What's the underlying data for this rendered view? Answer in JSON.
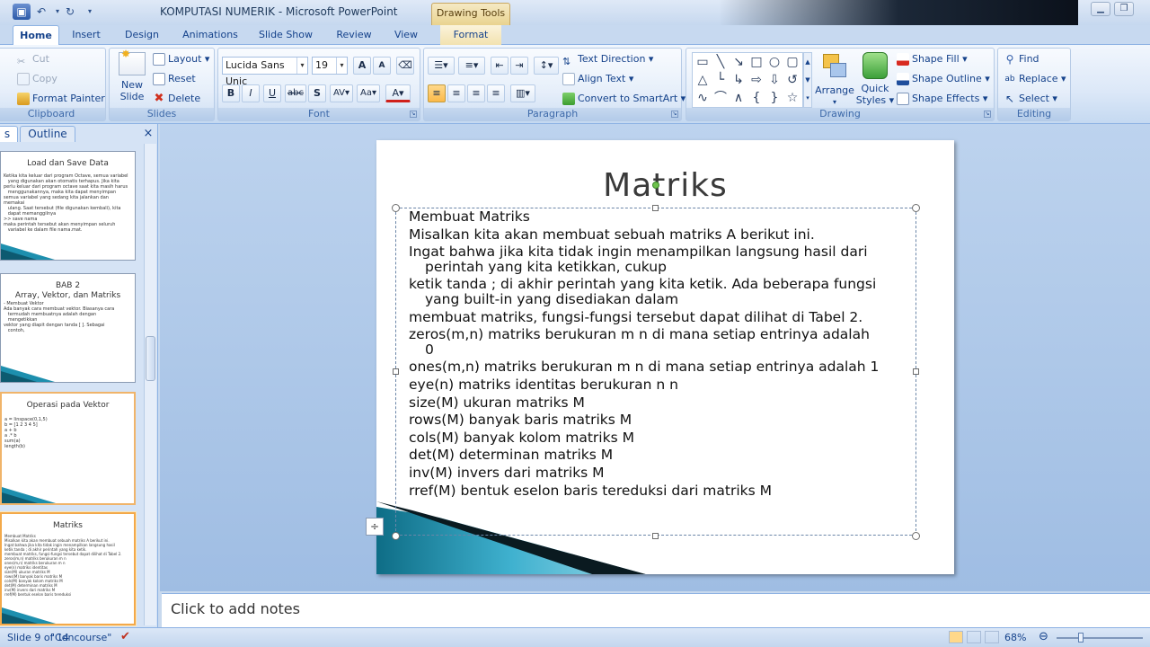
{
  "window": {
    "title": "KOMPUTASI NUMERIK - Microsoft PowerPoint",
    "context_tab": "Drawing Tools"
  },
  "tabs": [
    "Home",
    "Insert",
    "Design",
    "Animations",
    "Slide Show",
    "Review",
    "View",
    "Format"
  ],
  "ribbon": {
    "clipboard": {
      "label": "Clipboard",
      "cut": "Cut",
      "copy": "Copy",
      "format_painter": "Format Painter"
    },
    "slides": {
      "label": "Slides",
      "new_slide_1": "New",
      "new_slide_2": "Slide",
      "layout": "Layout",
      "reset": "Reset",
      "delete": "Delete"
    },
    "font": {
      "label": "Font",
      "family": "Lucida Sans Unic",
      "size": "19",
      "bold": "B",
      "italic": "I",
      "underline": "U",
      "strike": "abc",
      "shadow": "S",
      "spacing": "AV",
      "case": "Aa",
      "color": "A",
      "grow": "A",
      "shrink": "A"
    },
    "paragraph": {
      "label": "Paragraph",
      "text_direction": "Text Direction",
      "align_text": "Align Text",
      "smartart": "Convert to SmartArt"
    },
    "drawing": {
      "label": "Drawing",
      "arrange": "Arrange",
      "quick_styles_1": "Quick",
      "quick_styles_2": "Styles",
      "shape_fill": "Shape Fill",
      "shape_outline": "Shape Outline",
      "shape_effects": "Shape Effects"
    },
    "editing": {
      "label": "Editing",
      "find": "Find",
      "replace": "Replace",
      "select": "Select"
    }
  },
  "pane": {
    "tab_slides": "s",
    "tab_outline": "Outline",
    "close": "×",
    "thumbs": [
      {
        "title": "Load dan Save Data",
        "body": "Ketika kita keluar dari program Octave, semua variabel\n   yang digunakan akan otomatis terhapus. Jika kita\nperlu keluar dari program octave saat kita masih harus\n   menggunakannya, maka kita dapat menyimpan\nsemua variabel yang sedang kita jalankan dan memakai\n   ulang. Saat tersebut (file digunakan kembali), kita\n   dapat memanggilnya\n>> save nama\nmaka perintah tersebut akan menyimpan seluruh\n   variabel ke dalam file nama.mat."
      },
      {
        "title": "BAB 2\nArray, Vektor, dan Matriks",
        "body": "- Membuat Vektor\nAda banyak cara membuat vektor. Biasanya cara\n   termudah membuatnya adalah dengan\n   mengetikkan\nvektor yang diapit dengan tanda [ ]. Sebagai\n   contoh,"
      },
      {
        "title": "Operasi pada Vektor",
        "body": "a = linspace(0,1,5)\nb = [1 2 3 4 5]\na + b\na .* b\nsum(a)\nlength(b)"
      },
      {
        "title": "Matriks",
        "body": "Membuat Matriks\nMisalkan kita akan membuat sebuah matriks A berikut ini.\nIngat bahwa jika kita tidak ingin menampilkan langsung hasil\nketik tanda ; di akhir perintah yang kita ketik.\nmembuat matriks, fungsi-fungsi tersebut dapat dilihat di Tabel 2.\nzeros(m,n) matriks berukuran m n\nones(m,n) matriks berukuran m n\neye(n) matriks identitas\nsize(M) ukuran matriks M\nrows(M) banyak baris matriks M\ncols(M) banyak kolom matriks M\ndet(M) determinan matriks M\ninv(M) invers dari matriks M\nrref(M) bentuk eselon baris tereduksi"
      }
    ]
  },
  "slide": {
    "title": "Matriks",
    "lines": [
      {
        "text": "Membuat Matriks",
        "cont": false
      },
      {
        "text": "Misalkan kita akan membuat sebuah matriks A berikut ini.",
        "cont": false
      },
      {
        "text": "Ingat bahwa jika kita tidak ingin menampilkan langsung hasil dari",
        "cont": false
      },
      {
        "text": "perintah yang kita ketikkan, cukup",
        "cont": true
      },
      {
        "text": "ketik tanda ; di akhir perintah yang kita ketik. Ada beberapa fungsi",
        "cont": false
      },
      {
        "text": "yang built-in yang disediakan dalam",
        "cont": true
      },
      {
        "text": "membuat matriks, fungsi-fungsi tersebut dapat dilihat di Tabel 2.",
        "cont": false
      },
      {
        "text": "zeros(m,n) matriks berukuran m  n di mana setiap entrinya adalah",
        "cont": false
      },
      {
        "text": "0",
        "cont": true
      },
      {
        "text": "ones(m,n) matriks berukuran m  n di mana setiap entrinya adalah 1",
        "cont": false
      },
      {
        "text": "eye(n) matriks identitas berukuran n  n",
        "cont": false
      },
      {
        "text": "size(M) ukuran matriks M",
        "cont": false
      },
      {
        "text": "rows(M) banyak baris matriks M",
        "cont": false
      },
      {
        "text": "cols(M) banyak kolom matriks M",
        "cont": false
      },
      {
        "text": "det(M) determinan matriks M",
        "cont": false
      },
      {
        "text": "inv(M) invers dari matriks M",
        "cont": false
      },
      {
        "text": "rref(M) bentuk eselon baris tereduksi dari matriks M",
        "cont": false
      }
    ]
  },
  "notes": {
    "placeholder": "Click to add notes"
  },
  "status": {
    "slide": "9 of 14",
    "theme": "\"Concourse\"",
    "zoom": "68%"
  }
}
